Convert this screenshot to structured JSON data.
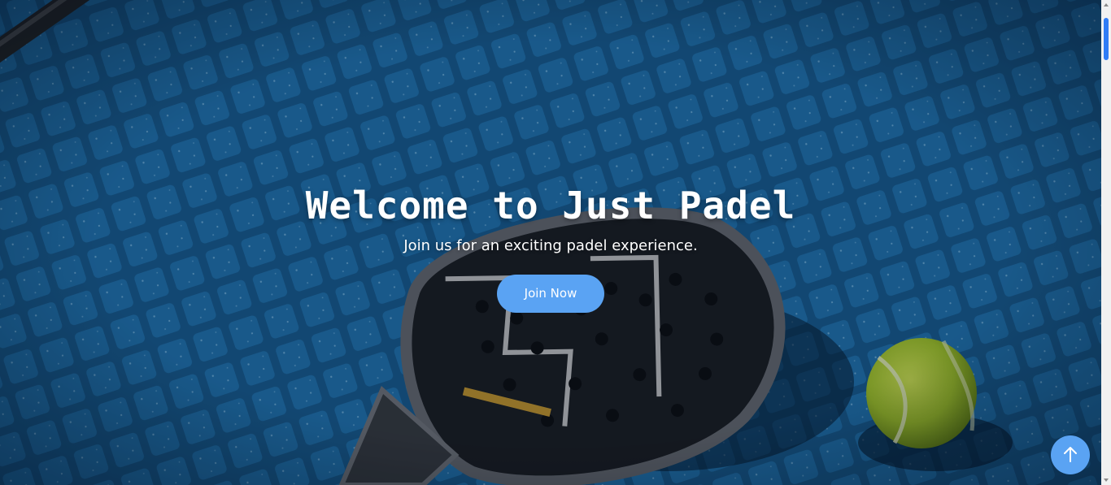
{
  "hero": {
    "title": "Welcome to Just Padel",
    "subtitle": "Join us for an exciting padel experience.",
    "join_label": "Join Now",
    "background_image": "padel-racket-and-ball-on-blue-court",
    "accent_color": "#5aa3f3"
  },
  "back_to_top": {
    "icon": "arrow-up-icon"
  },
  "scrollbar": {
    "position": 0.0
  }
}
